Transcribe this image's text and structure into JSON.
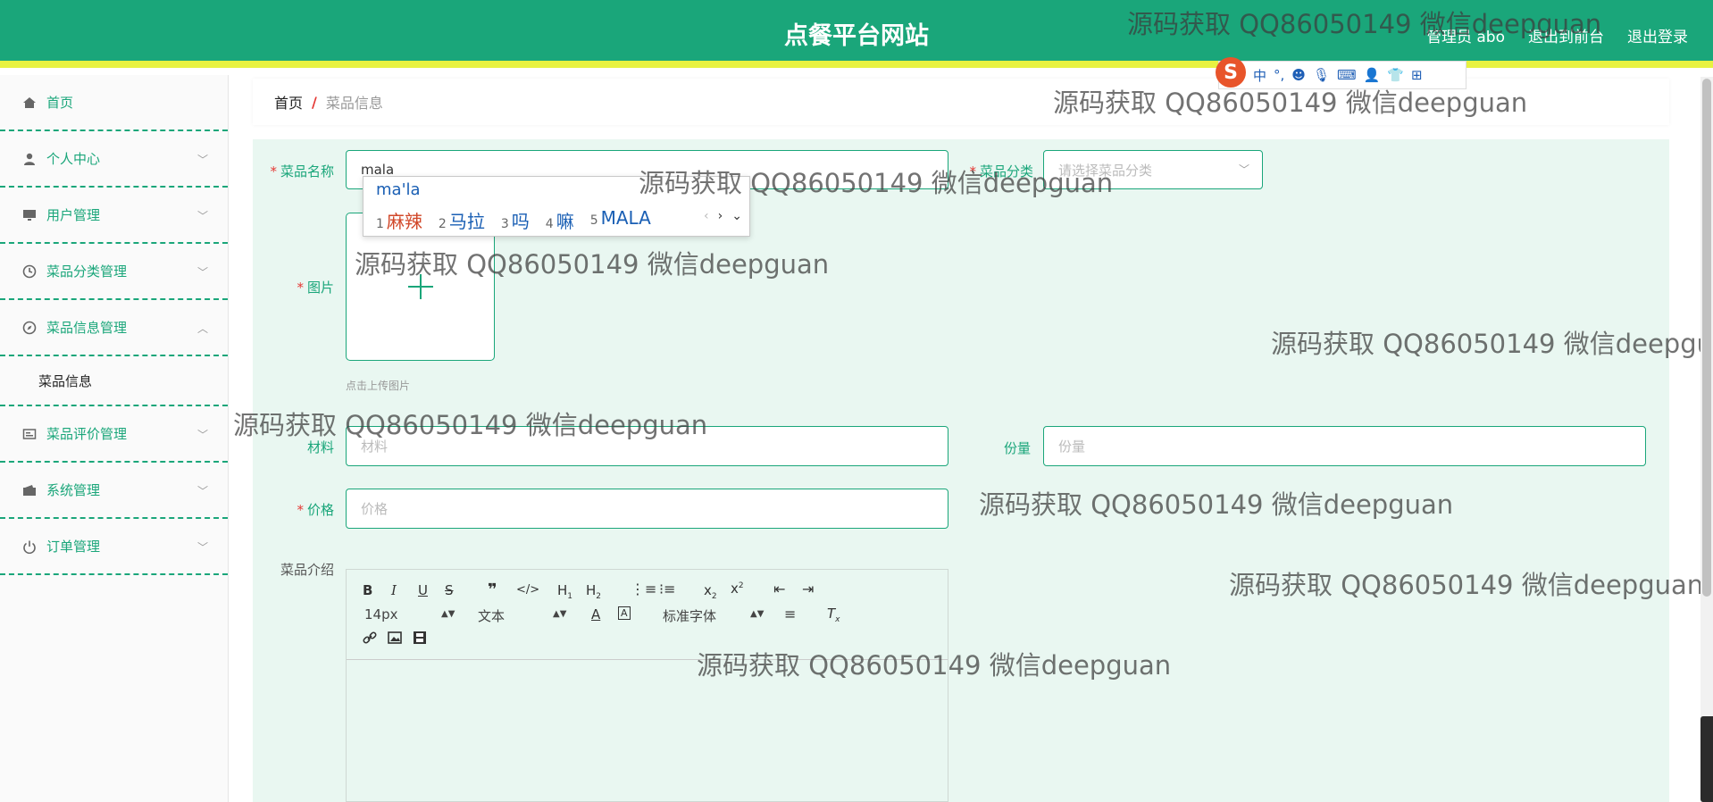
{
  "header": {
    "title": "点餐平台网站",
    "links": [
      "管理员 abo",
      "退出到前台",
      "退出登录"
    ]
  },
  "sidebar": {
    "items": [
      {
        "label": "首页",
        "icon": "home-icon"
      },
      {
        "label": "个人中心",
        "icon": "user-icon"
      },
      {
        "label": "用户管理",
        "icon": "monitor-icon"
      },
      {
        "label": "菜品分类管理",
        "icon": "clock-icon"
      },
      {
        "label": "菜品信息管理",
        "icon": "compass-icon"
      },
      {
        "label": "菜品评价管理",
        "icon": "card-icon"
      },
      {
        "label": "系统管理",
        "icon": "wallet-icon"
      },
      {
        "label": "订单管理",
        "icon": "power-icon"
      }
    ],
    "sub_item": "菜品信息"
  },
  "breadcrumb": {
    "home": "首页",
    "separator": "/",
    "current": "菜品信息"
  },
  "form": {
    "name_label": "菜品名称",
    "name_value": "mala",
    "category_label": "菜品分类",
    "category_placeholder": "请选择菜品分类",
    "image_label": "图片",
    "upload_hint": "点击上传图片",
    "material_label": "材料",
    "material_placeholder": "材料",
    "portion_label": "份量",
    "portion_placeholder": "份量",
    "price_label": "价格",
    "price_placeholder": "价格",
    "intro_label": "菜品介绍"
  },
  "editor": {
    "font_size": "14px",
    "paragraph": "文本",
    "font_family": "标准字体"
  },
  "ime": {
    "composition": "ma'la",
    "candidates": [
      {
        "num": "1",
        "text": "麻辣"
      },
      {
        "num": "2",
        "text": "马拉"
      },
      {
        "num": "3",
        "text": "吗"
      },
      {
        "num": "4",
        "text": "嘛"
      },
      {
        "num": "5",
        "text": "MALA"
      }
    ]
  },
  "sogou": {
    "mode": "中",
    "punct": "°,"
  },
  "watermark": "源码获取 QQ86050149 微信deepguan",
  "colors": {
    "primary": "#1aa67a",
    "accent": "#e8f241",
    "required": "#e53935"
  }
}
